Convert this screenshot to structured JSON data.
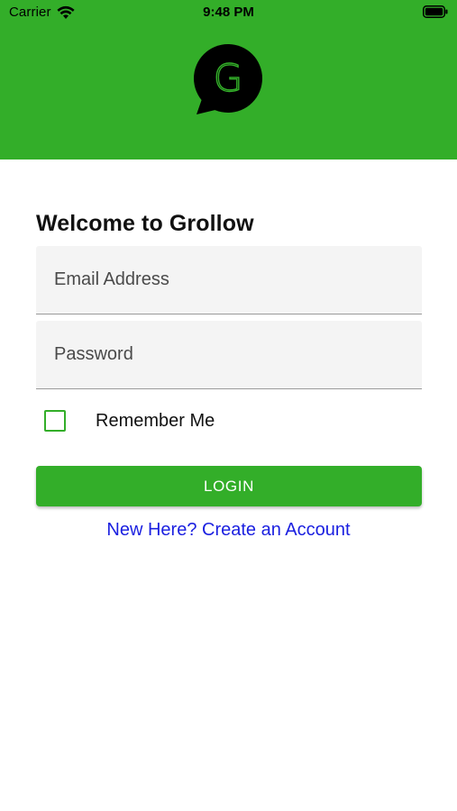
{
  "status_bar": {
    "carrier": "Carrier",
    "time": "9:48 PM",
    "icons": [
      "wifi-icon",
      "battery-icon"
    ]
  },
  "header": {
    "background_color": "#33ae29",
    "logo": {
      "letter": "G",
      "icon": "speech-bubble-logo-icon"
    }
  },
  "login": {
    "title": "Welcome to Grollow",
    "email_placeholder": "Email Address",
    "email_value": "",
    "password_placeholder": "Password",
    "password_value": "",
    "remember_label": "Remember Me",
    "remember_checked": false,
    "login_label": "LOGIN",
    "create_account_label": "New Here? Create an Account"
  },
  "colors": {
    "accent": "#33ae29",
    "link": "#1a1fe0",
    "field_background": "#f4f4f4"
  }
}
